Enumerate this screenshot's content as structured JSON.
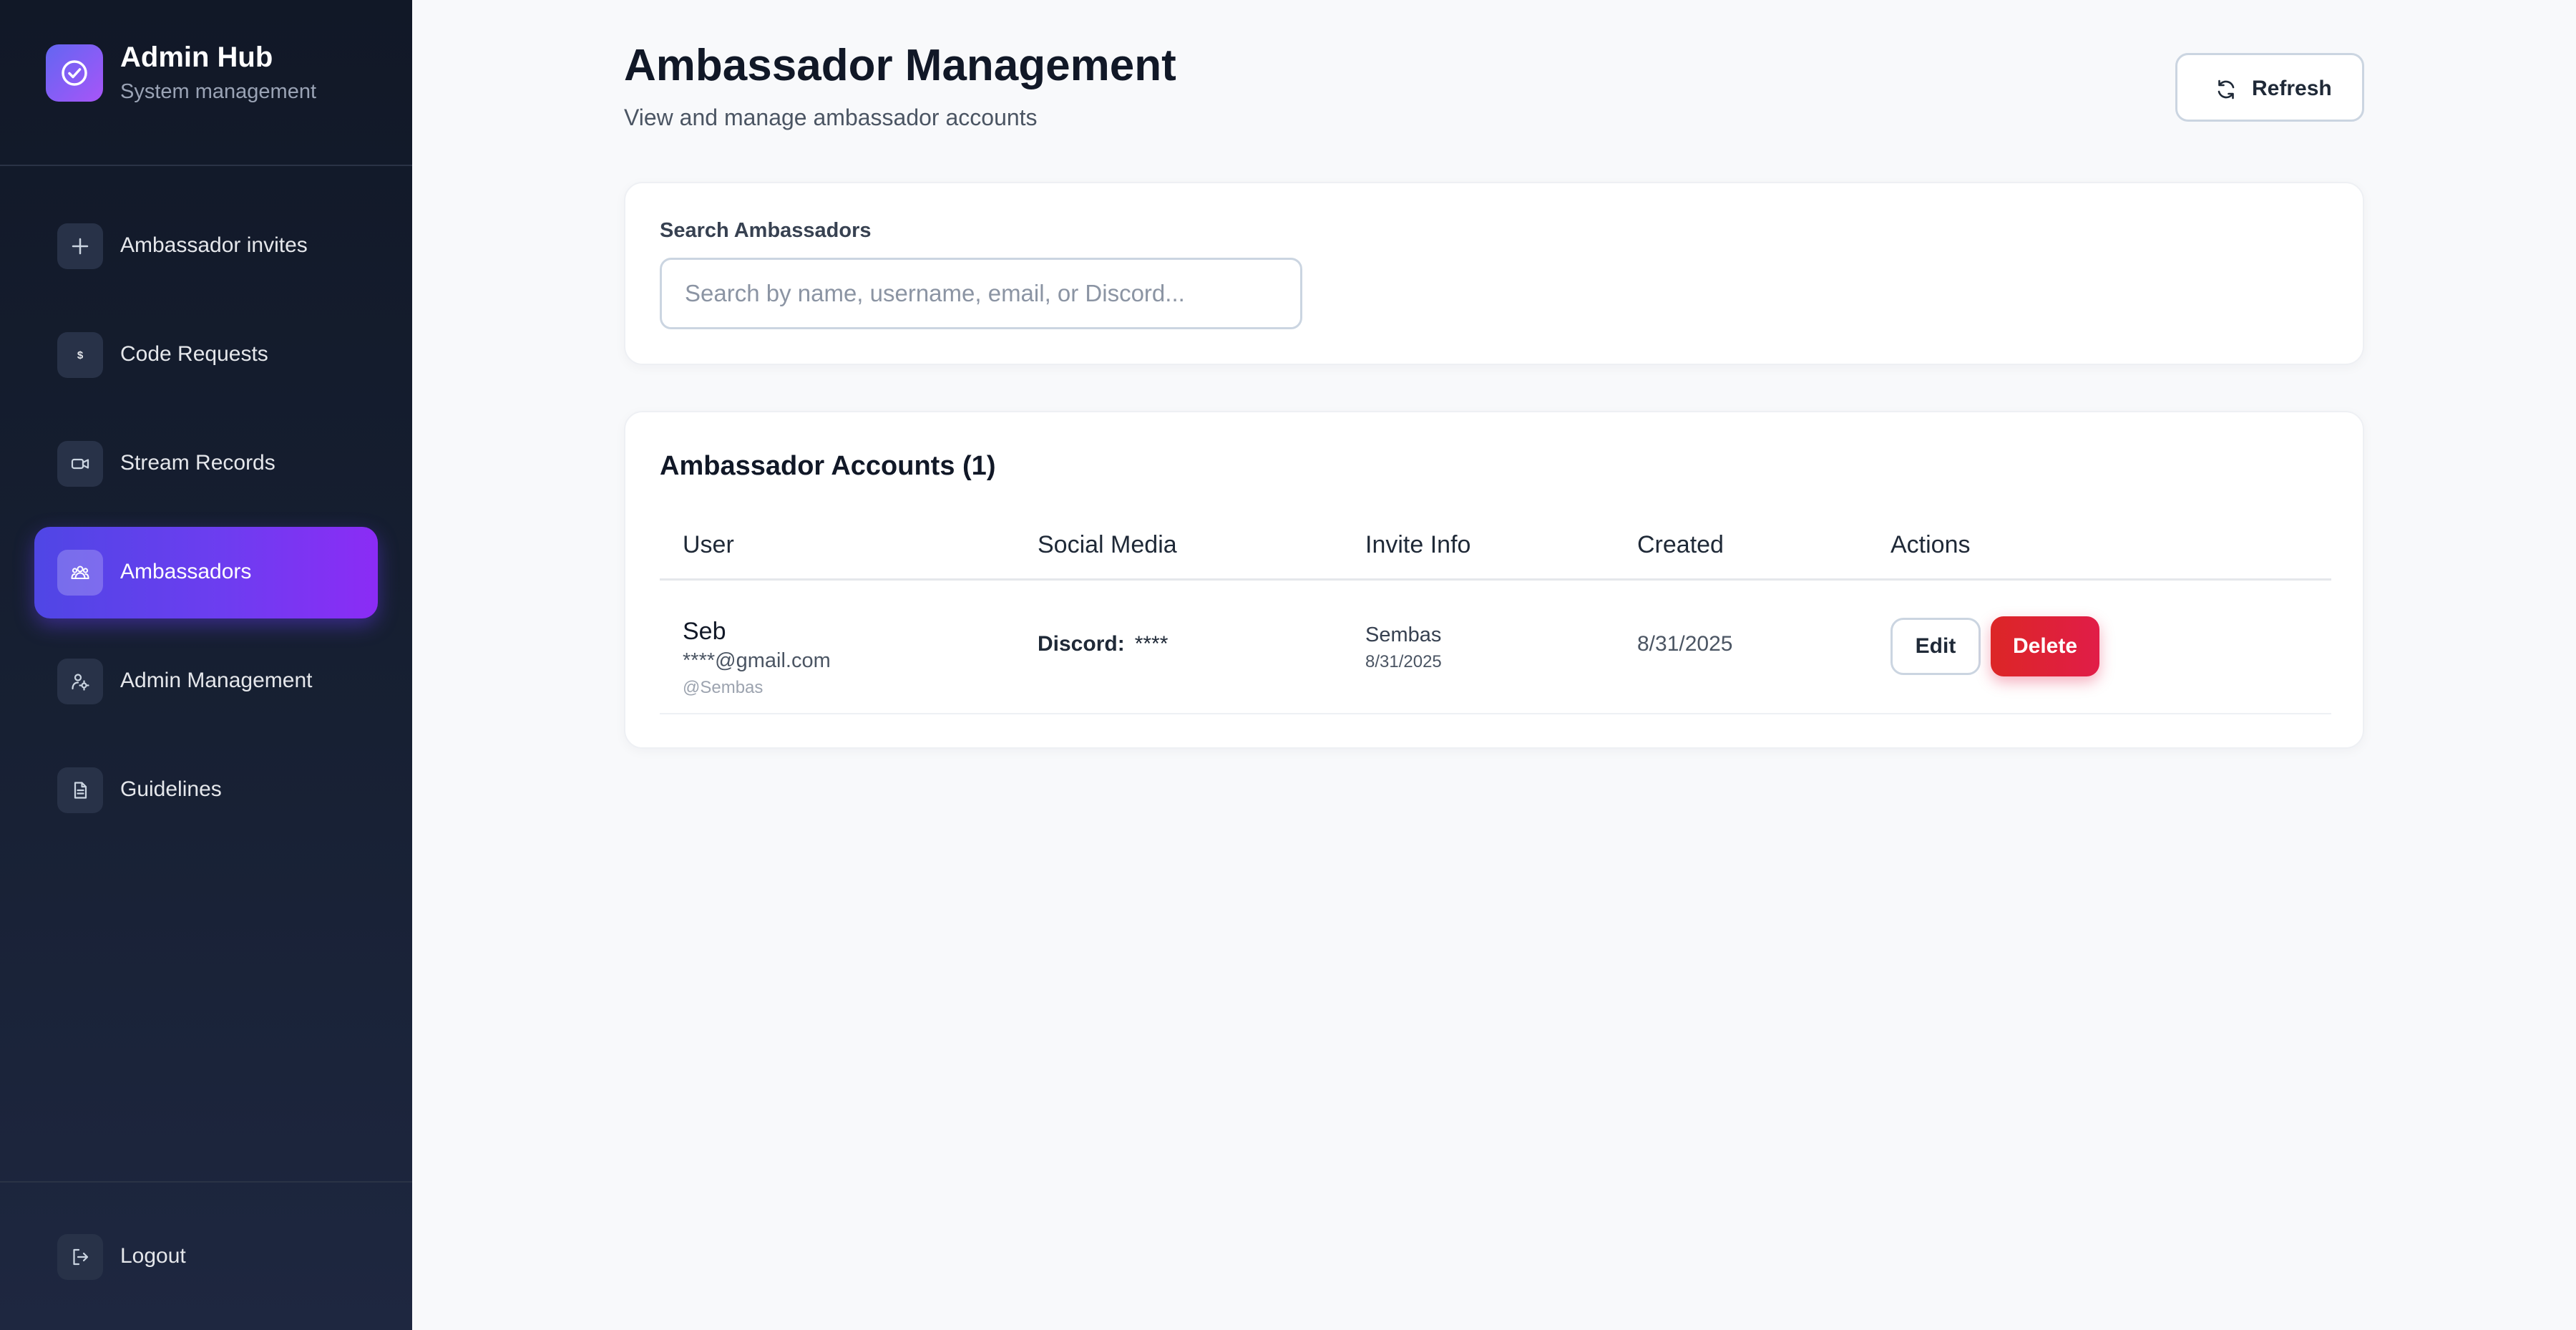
{
  "brand": {
    "title": "Admin Hub",
    "subtitle": "System management",
    "logo_icon": "check-circle-icon"
  },
  "sidebar": {
    "items": [
      {
        "label": "Ambassador invites",
        "icon": "plus-icon",
        "active": false
      },
      {
        "label": "Code Requests",
        "icon": "dollar-icon",
        "active": false
      },
      {
        "label": "Stream Records",
        "icon": "video-icon",
        "active": false
      },
      {
        "label": "Ambassadors",
        "icon": "users-icon",
        "active": true
      },
      {
        "label": "Admin Management",
        "icon": "user-cog-icon",
        "active": false
      },
      {
        "label": "Guidelines",
        "icon": "document-icon",
        "active": false
      }
    ],
    "logout": {
      "label": "Logout",
      "icon": "logout-icon"
    }
  },
  "header": {
    "title": "Ambassador Management",
    "subtitle": "View and manage ambassador accounts",
    "refresh_label": "Refresh"
  },
  "search": {
    "label": "Search Ambassadors",
    "placeholder": "Search by name, username, email, or Discord...",
    "value": ""
  },
  "table": {
    "title": "Ambassador Accounts (1)",
    "columns": [
      "User",
      "Social Media",
      "Invite Info",
      "Created",
      "Actions"
    ],
    "rows": [
      {
        "name": "Seb",
        "email": "****@gmail.com",
        "username": "@Sembas",
        "social_label": "Discord:",
        "social_value": "****",
        "invited_by": "Sembas",
        "invite_date": "8/31/2025",
        "created": "8/31/2025",
        "edit_label": "Edit",
        "delete_label": "Delete"
      }
    ]
  },
  "colors": {
    "sidebar_bg": "#111827",
    "accent_start": "#4f46e5",
    "accent_end": "#8b2cf5",
    "danger": "#e11d48",
    "page_bg": "#f8f9fb"
  }
}
